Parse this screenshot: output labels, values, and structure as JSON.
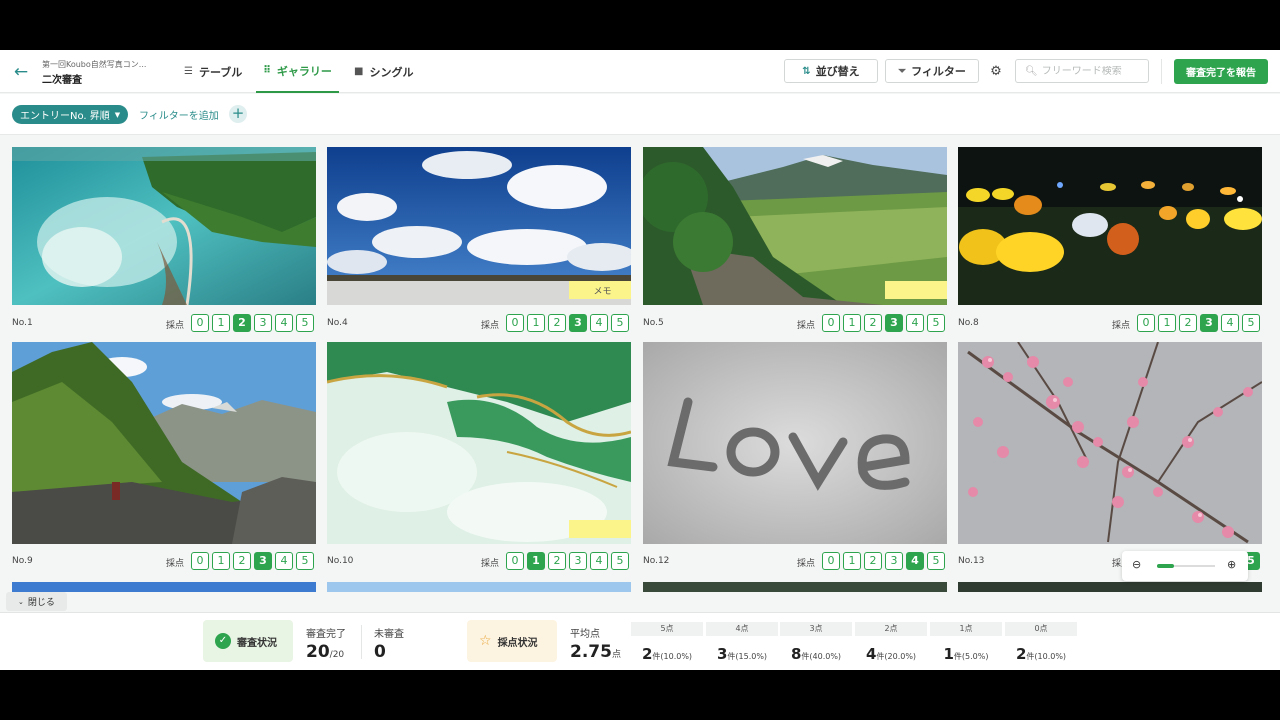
{
  "header": {
    "competition": "第一回Koubo自然写真コン...",
    "stage": "二次審査",
    "tabs": [
      {
        "label": "テーブル",
        "icon": "list-icon"
      },
      {
        "label": "ギャラリー",
        "icon": "grid-icon"
      },
      {
        "label": "シングル",
        "icon": "single-icon"
      }
    ],
    "active_tab": "ギャラリー",
    "sort_label": "並び替え",
    "filter_label": "フィルター",
    "search_placeholder": "フリーワード検索",
    "report_label": "審査完了を報告"
  },
  "filterbar": {
    "chip_label": "エントリーNo. 昇順",
    "add_filter_label": "フィルターを追加"
  },
  "gallery": {
    "score_label": "採点",
    "score_options": [
      "0",
      "1",
      "2",
      "3",
      "4",
      "5"
    ],
    "entries": [
      {
        "no": "No.1",
        "score": 2,
        "memo": ""
      },
      {
        "no": "No.4",
        "score": 3,
        "memo": "メモ"
      },
      {
        "no": "No.5",
        "score": 3,
        "memo": ""
      },
      {
        "no": "No.8",
        "score": 3,
        "memo": null
      },
      {
        "no": "No.9",
        "score": 3,
        "memo": null
      },
      {
        "no": "No.10",
        "score": 1,
        "memo": ""
      },
      {
        "no": "No.12",
        "score": 4,
        "memo": null
      },
      {
        "no": "No.13",
        "score": 5,
        "memo": null
      }
    ]
  },
  "zoom": {
    "level": 0.3
  },
  "collapse_label": "閉じる",
  "stats": {
    "review_status_label": "審査状況",
    "completed_label": "審査完了",
    "completed_value": "20",
    "completed_total": "/20",
    "pending_label": "未審査",
    "pending_value": "0",
    "scoring_status_label": "採点状況",
    "average_label": "平均点",
    "average_value": "2.75",
    "average_unit": "点",
    "distribution": [
      {
        "label": "5点",
        "count": "2",
        "detail": "件(10.0%)"
      },
      {
        "label": "4点",
        "count": "3",
        "detail": "件(15.0%)"
      },
      {
        "label": "3点",
        "count": "8",
        "detail": "件(40.0%)"
      },
      {
        "label": "2点",
        "count": "4",
        "detail": "件(20.0%)"
      },
      {
        "label": "1点",
        "count": "1",
        "detail": "件(5.0%)"
      },
      {
        "label": "0点",
        "count": "2",
        "detail": "件(10.0%)"
      }
    ]
  },
  "colors": {
    "brand_green": "#2ea44f",
    "teal": "#2a8c8a",
    "memo_yellow": "#fbf48a"
  }
}
